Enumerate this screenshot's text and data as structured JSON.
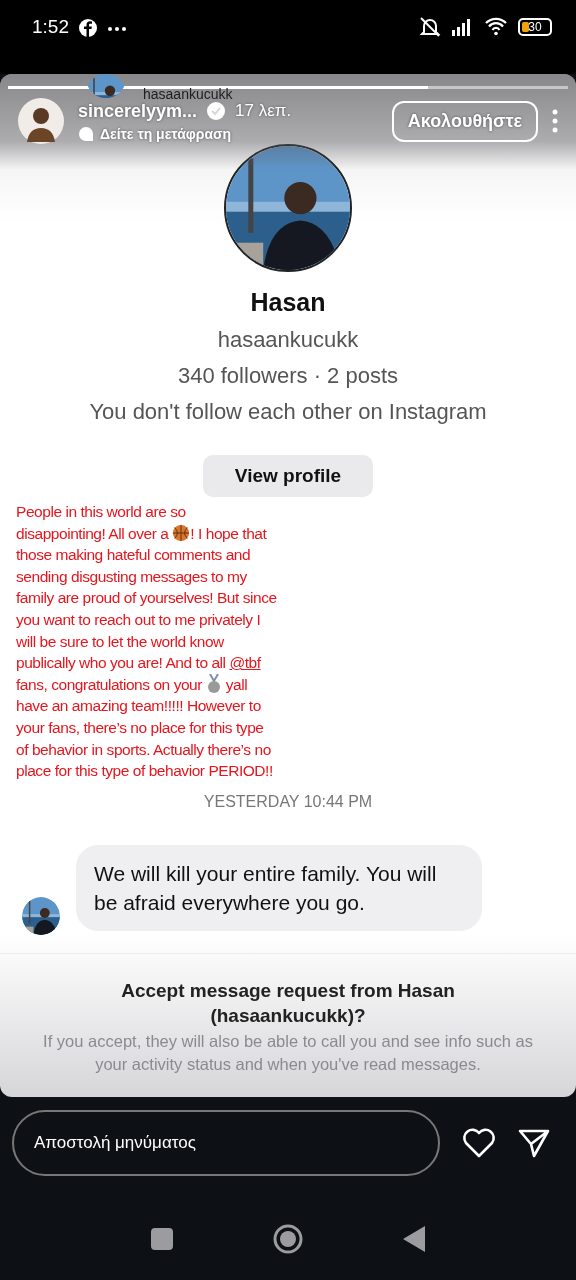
{
  "status_bar": {
    "time": "1:52",
    "battery": "30"
  },
  "story_header": {
    "dm_username": "hasaankucukk",
    "username": "sincerelyym...",
    "age": "17 λεπ.",
    "translate": "Δείτε τη μετάφραση",
    "follow_button": "Ακολουθήστε",
    "verified": true,
    "progress": {
      "level": 0.75
    }
  },
  "profile": {
    "name": "Hasan",
    "username": "hasaankucukk",
    "stats": "340 followers · 2 posts",
    "relation": "You don't follow each other on Instagram",
    "view_button": "View profile"
  },
  "story_text": [
    {
      "kind": "text",
      "text": "People in this world are so disappointing! All over a "
    },
    {
      "kind": "ball"
    },
    {
      "kind": "text",
      "text": "! I hope that those making hateful comments and sending disgusting messages to my family are proud of yourselves! But since you want to reach out to me privately I will be sure to let the world know publically who you are! And to all "
    },
    {
      "kind": "mention",
      "text": "@tbf"
    },
    {
      "kind": "text",
      "text": " fans, congratulations on your "
    },
    {
      "kind": "medal"
    },
    {
      "kind": "text",
      "text": " yall have an amazing team!!!!! However to your fans, there’s no place for this type of behavior in sports. Actually there’s no place for this type of behavior PERIOD!!"
    }
  ],
  "timestamp": "YESTERDAY 10:44 PM",
  "message": "We will kill your entire family. You will be afraid everywhere you go.",
  "request": {
    "title": "Accept message request from Hasan (hasaankucukk)?",
    "body": "If you accept, they will also be able to call you and see info such as your activity status and when you've read messages."
  },
  "reply": {
    "placeholder": "Αποστολή μηνύματος"
  }
}
